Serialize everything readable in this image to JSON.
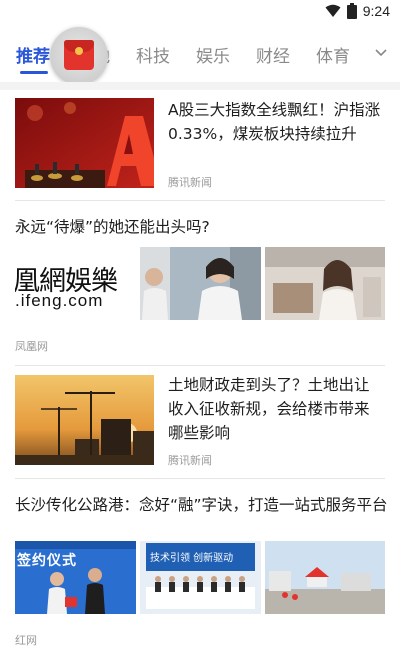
{
  "status_bar": {
    "time": "9:24"
  },
  "tabs": [
    {
      "label": "推荐",
      "active": true
    },
    {
      "label": "本地",
      "active": false
    },
    {
      "label": "科技",
      "active": false
    },
    {
      "label": "娱乐",
      "active": false
    },
    {
      "label": "财经",
      "active": false
    },
    {
      "label": "体育",
      "active": false
    }
  ],
  "feed": [
    {
      "title": "A股三大指数全线飘红！沪指涨0.33%，煤炭板块持续拉升",
      "source": "腾讯新闻",
      "thumb_text": "A"
    },
    {
      "title": "永远“待爆”的她还能出头吗?",
      "source": "凤凰网",
      "logo_top": "凰網娛樂",
      "logo_bottom": ".ifeng.com"
    },
    {
      "title": "土地财政走到头了？土地出让收入征收新规，会给楼市带来哪些影响",
      "source": "腾讯新闻"
    },
    {
      "title": "长沙传化公路港：念好“融”字诀，打造一站式服务平台",
      "source": "红网",
      "photo1_text": "签约仪式",
      "photo2_text": "技术引领 创新驱动"
    }
  ],
  "colors": {
    "accent": "#2a57d9",
    "red_packet": "#e2342d"
  }
}
